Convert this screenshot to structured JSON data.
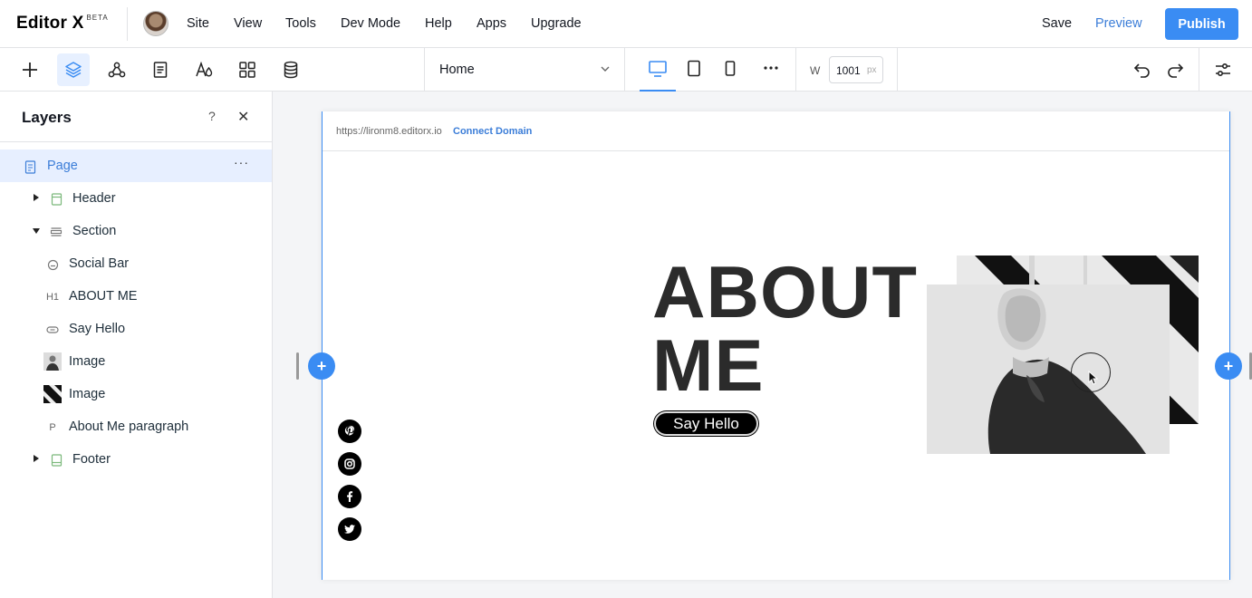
{
  "topbar": {
    "logo": "Editor X",
    "beta": "BETA",
    "menu": [
      "Site",
      "View",
      "Tools",
      "Dev Mode",
      "Help",
      "Apps",
      "Upgrade"
    ],
    "save": "Save",
    "preview": "Preview",
    "publish": "Publish"
  },
  "toolbar": {
    "tools": [
      "add-icon",
      "layers-icon",
      "connect-icon",
      "pages-icon",
      "design-icon",
      "apps-grid-icon",
      "database-icon"
    ],
    "page_select": "Home",
    "devices": [
      "desktop-icon",
      "tablet-icon",
      "mobile-icon",
      "more-icon"
    ],
    "width_label": "W",
    "width_value": "1001",
    "width_unit": "px"
  },
  "layers": {
    "title": "Layers",
    "help": "?",
    "items": [
      {
        "label": "Page",
        "icon": "page-icon"
      },
      {
        "label": "Header",
        "icon": "header-icon"
      },
      {
        "label": "Section",
        "icon": "section-icon"
      },
      {
        "label": "Social Bar",
        "icon": "social-bar-icon"
      },
      {
        "label": "ABOUT ME",
        "icon": "H1"
      },
      {
        "label": "Say Hello",
        "icon": "button-icon"
      },
      {
        "label": "Image",
        "icon": "image-thumb-portrait"
      },
      {
        "label": "Image",
        "icon": "image-thumb-stripes"
      },
      {
        "label": "About Me paragraph",
        "icon": "P"
      },
      {
        "label": "Footer",
        "icon": "footer-icon"
      }
    ]
  },
  "canvas": {
    "url": "https://lironm8.editorx.io",
    "connect_domain": "Connect Domain",
    "headline_line1": "ABOUT",
    "headline_line2": "ME",
    "button": "Say Hello",
    "social_icons": [
      "pinterest-icon",
      "instagram-icon",
      "facebook-icon",
      "twitter-icon"
    ]
  }
}
